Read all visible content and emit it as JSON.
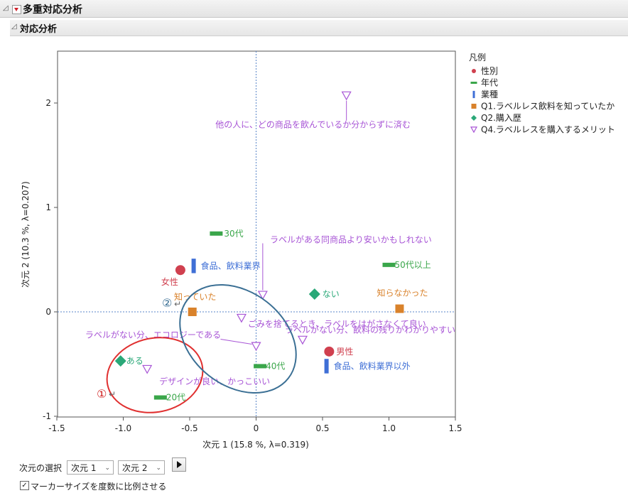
{
  "header": {
    "title": "多重対応分析",
    "subtitle": "対応分析"
  },
  "controls": {
    "dim_label": "次元の選択",
    "dim1": "次元 1",
    "dim2": "次元 2",
    "checkbox_label": "マーカーサイズを度数に比例させる",
    "checkbox_checked": true
  },
  "chart_data": {
    "type": "scatter",
    "xlabel": "次元 1  (15.8 %, λ=0.319)",
    "ylabel": "次元 2  (10.3 %, λ=0.207)",
    "xlim": [
      -1.5,
      1.5
    ],
    "ylim": [
      -1,
      2.5
    ],
    "xticks": [
      "-1.5",
      "-1.0",
      "-0.5",
      "0",
      "0.5",
      "1.0",
      "1.5"
    ],
    "yticks": [
      "-1",
      "0",
      "1",
      "2"
    ],
    "legend_title": "凡例",
    "legend_position": "right",
    "groups": [
      {
        "name": "性別",
        "marker": "circle",
        "color": "#d0404f",
        "points": [
          {
            "label": "女性",
            "x": -0.57,
            "y": 0.4
          },
          {
            "label": "男性",
            "x": 0.55,
            "y": -0.38
          }
        ]
      },
      {
        "name": "年代",
        "marker": "bar-h",
        "color": "#3aa64a",
        "points": [
          {
            "label": "30代",
            "x": -0.3,
            "y": 0.75
          },
          {
            "label": "50代以上",
            "x": 1.0,
            "y": 0.45
          },
          {
            "label": "40代",
            "x": 0.03,
            "y": -0.52
          },
          {
            "label": "20代",
            "x": -0.72,
            "y": -0.82
          }
        ]
      },
      {
        "name": "業種",
        "marker": "bar-v",
        "color": "#3f6fd6",
        "points": [
          {
            "label": "食品、飲料業界",
            "x": -0.47,
            "y": 0.44
          },
          {
            "label": "食品、飲料業界以外",
            "x": 0.53,
            "y": -0.52
          }
        ]
      },
      {
        "name": "Q1.ラベルレス飲料を知っていたか",
        "marker": "square",
        "color": "#d9822b",
        "points": [
          {
            "label": "知っていた",
            "x": -0.48,
            "y": 0.0
          },
          {
            "label": "知らなかった",
            "x": 1.08,
            "y": 0.03
          }
        ]
      },
      {
        "name": "Q2.購入歴",
        "marker": "diamond",
        "color": "#2aa878",
        "points": [
          {
            "label": "ない",
            "x": 0.44,
            "y": 0.17
          },
          {
            "label": "ある",
            "x": -1.02,
            "y": -0.47
          }
        ]
      },
      {
        "name": "Q4.ラベルレスを購入するメリット",
        "marker": "triangle-down",
        "color": "#a855d6",
        "points": [
          {
            "label": "他の人に、どの商品を飲んでいるか分からずに済む",
            "x": 0.68,
            "y": 2.07
          },
          {
            "label": "ラベルがある同商品より安いかもしれない",
            "x": 0.05,
            "y": 0.16
          },
          {
            "label": "ごみを捨てるとき、ラベルをはがさなくて良い",
            "x": -0.11,
            "y": -0.06
          },
          {
            "label": "ラベルがない分、飲料の残りがわかりやすい",
            "x": 0.35,
            "y": -0.27
          },
          {
            "label": "ラベルがない分、エコロジーである",
            "x": 0.0,
            "y": -0.33
          },
          {
            "label": "デザインが良い、かっこいい",
            "x": -0.82,
            "y": -0.55
          }
        ]
      }
    ],
    "annotations": [
      {
        "text": "①",
        "color": "#d02020",
        "shape": "ellipse",
        "outline_color": "#e03030"
      },
      {
        "text": "②",
        "color": "#3a6f94",
        "shape": "ellipse",
        "outline_color": "#3a6f94"
      }
    ]
  }
}
